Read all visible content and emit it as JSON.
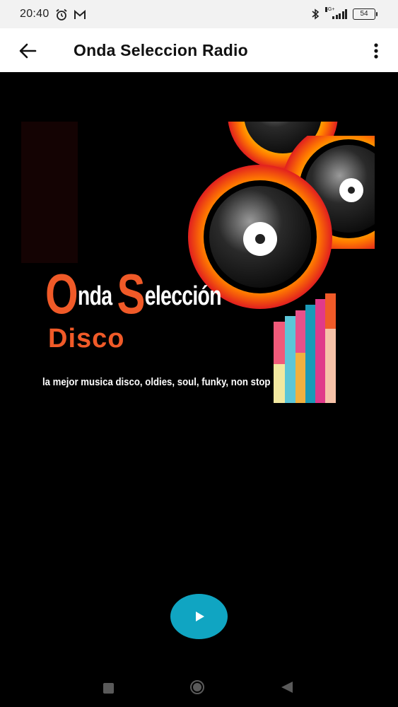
{
  "status_bar": {
    "time": "20:40",
    "network_label": "4G+",
    "battery": "54"
  },
  "app_bar": {
    "title": "Onda Seleccion Radio"
  },
  "artwork": {
    "logo_first_initial": "O",
    "logo_first_rest": "nda",
    "logo_second_initial": "S",
    "logo_second_rest": "elección",
    "logo_subtitle": "Disco",
    "tagline": "la mejor musica disco, oldies, soul, funky, non stop"
  },
  "colors": {
    "accent_play": "#10a5c2",
    "logo_orange": "#f05a28"
  },
  "icons": {
    "back": "arrow-left-icon",
    "menu": "more-vert-icon",
    "play": "play-icon"
  }
}
